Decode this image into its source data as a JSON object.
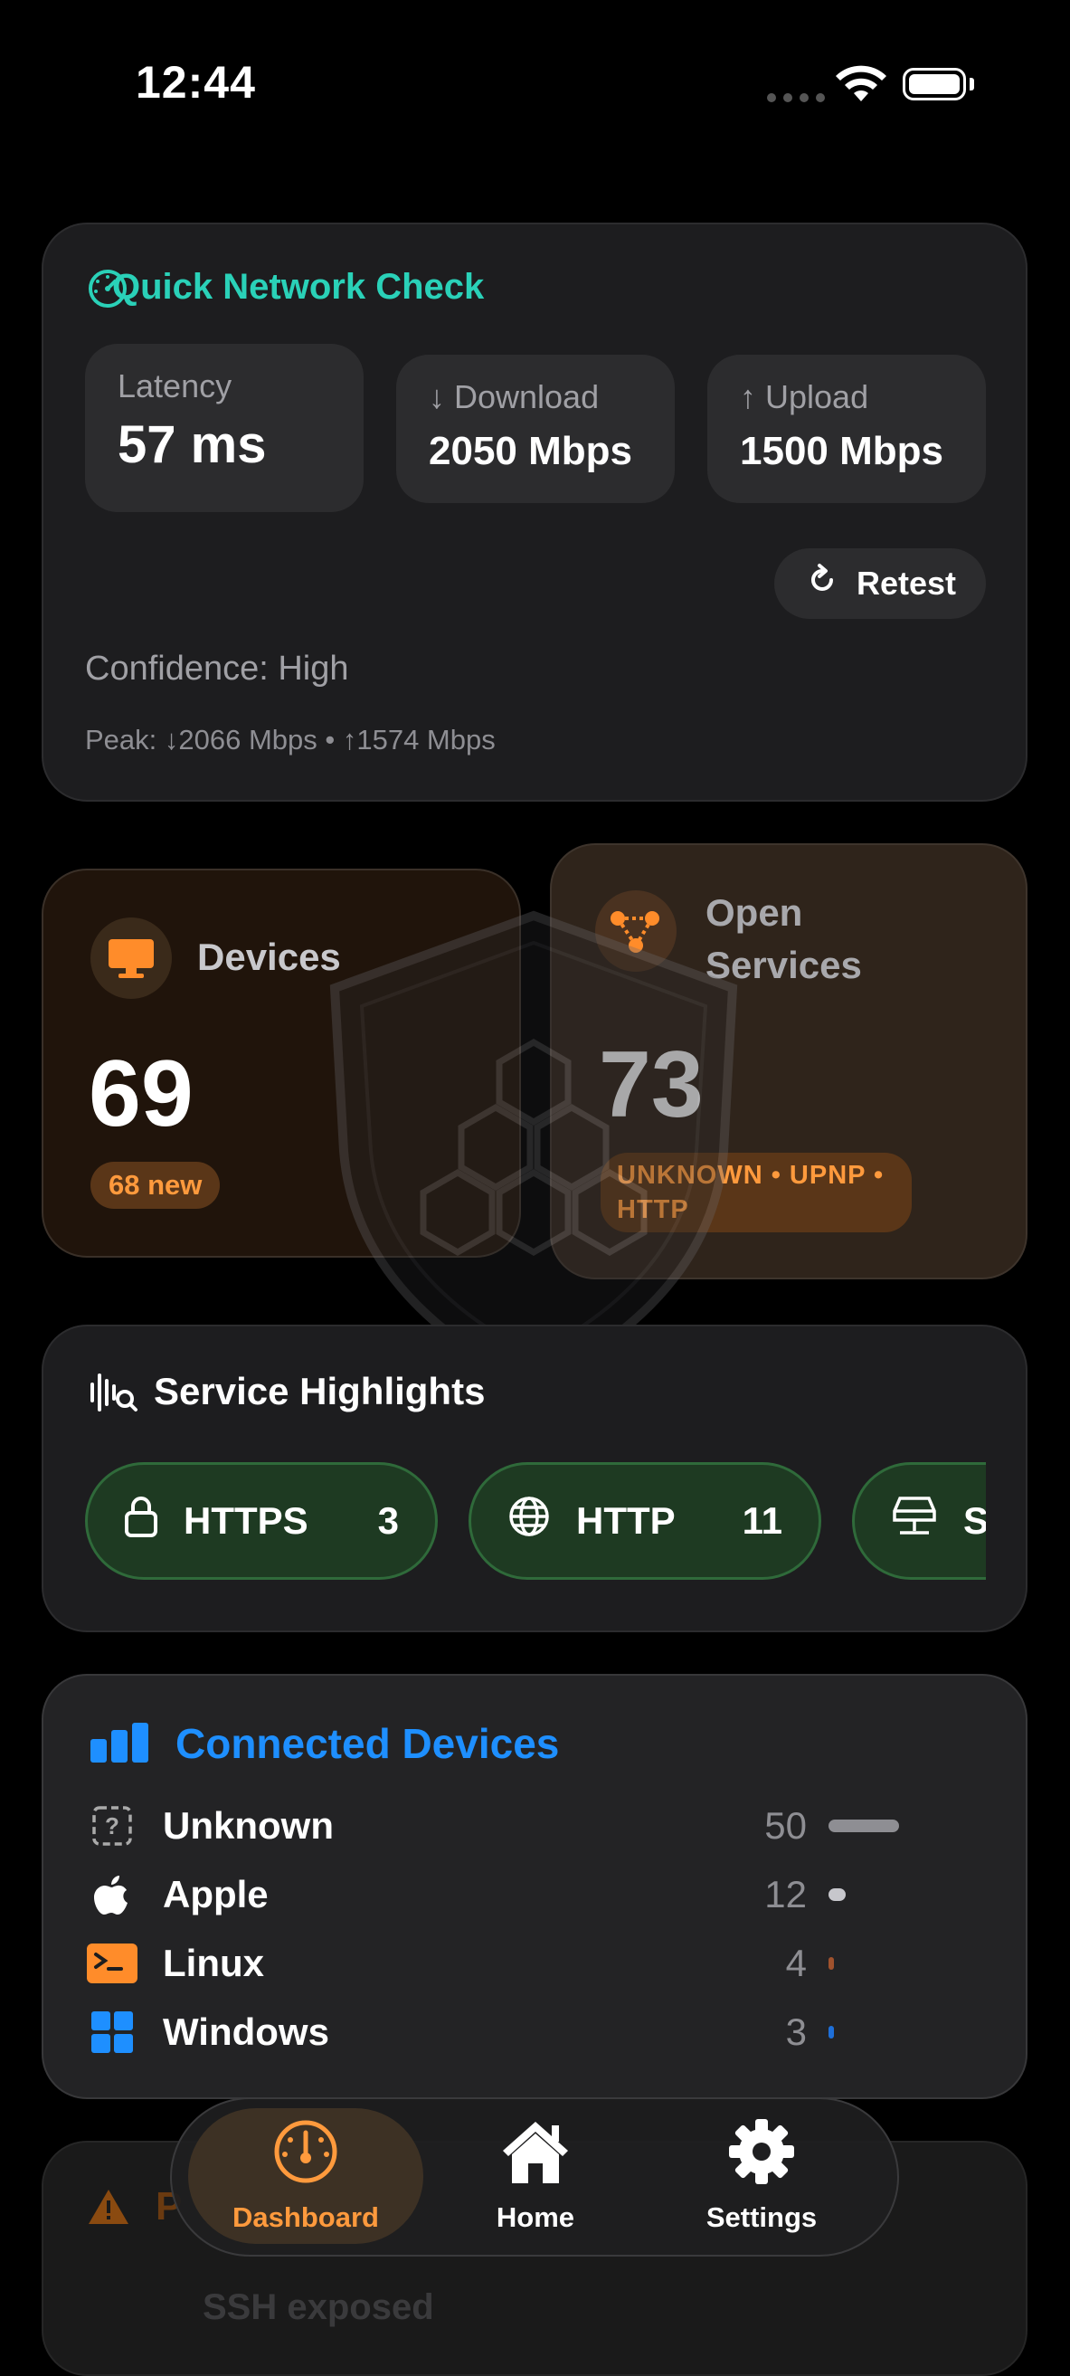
{
  "status_bar": {
    "time": "12:44"
  },
  "quick_check": {
    "title": "Quick Network Check",
    "latency_label": "Latency",
    "latency_value": "57 ms",
    "download_label": "↓ Download",
    "download_value": "2050 Mbps",
    "upload_label": "↑ Upload",
    "upload_value": "1500 Mbps",
    "retest_label": "Retest",
    "confidence": "Confidence: High",
    "peak": "Peak: ↓2066 Mbps • ↑1574 Mbps"
  },
  "devices_card": {
    "title": "Devices",
    "count": "69",
    "badge": "68 new"
  },
  "services_card": {
    "title": "Open Services",
    "count": "73",
    "badge": "UNKNOWN • UPNP • HTTP"
  },
  "service_highlights": {
    "title": "Service Highlights",
    "pills": [
      {
        "icon": "lock-icon",
        "label": "HTTPS",
        "count": "3"
      },
      {
        "icon": "globe-icon",
        "label": "HTTP",
        "count": "11"
      },
      {
        "icon": "server-icon",
        "label": "S",
        "count": ""
      }
    ]
  },
  "connected_devices": {
    "title": "Connected Devices",
    "rows": [
      {
        "name": "Unknown",
        "count": "50",
        "fraction": 0.6,
        "color": "#8e8e93"
      },
      {
        "name": "Apple",
        "count": "12",
        "fraction": 0.144,
        "color": "#c7c7cc"
      },
      {
        "name": "Linux",
        "count": "4",
        "fraction": 0.048,
        "color": "#a0522d"
      },
      {
        "name": "Windows",
        "count": "3",
        "fraction": 0.036,
        "color": "#1e6fd9"
      }
    ]
  },
  "partial_card": {
    "title_fragment": "P",
    "line": "SSH exposed"
  },
  "tabbar": {
    "dashboard": "Dashboard",
    "home": "Home",
    "settings": "Settings"
  },
  "colors": {
    "accent_teal": "#2ad1b8",
    "accent_orange": "#ff9a3d",
    "accent_blue": "#1e8fff"
  }
}
